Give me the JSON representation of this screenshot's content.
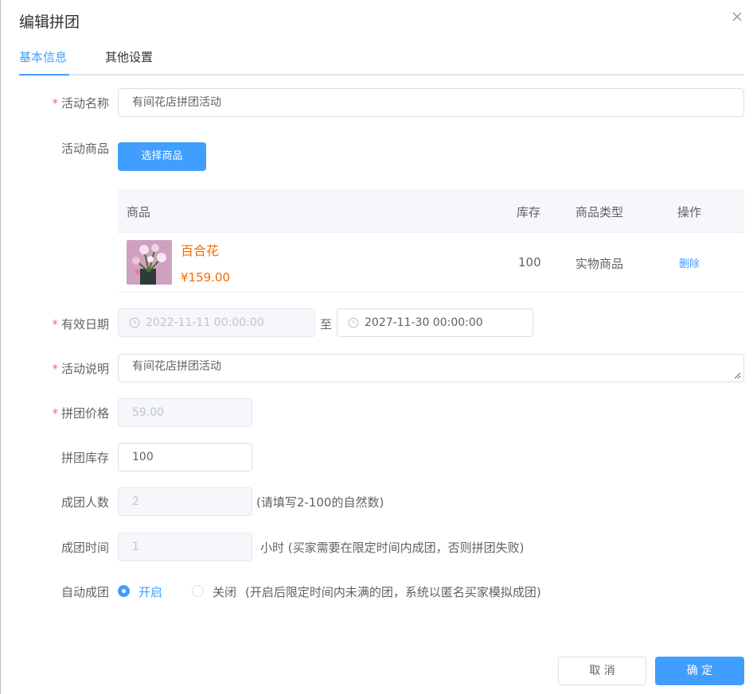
{
  "dialog": {
    "title": "编辑拼团"
  },
  "tabs": [
    {
      "label": "基本信息",
      "active": true
    },
    {
      "label": "其他设置",
      "active": false
    }
  ],
  "form": {
    "activity_name": {
      "label": "活动名称",
      "value": "有间花店拼团活动",
      "required": true
    },
    "activity_goods": {
      "label": "活动商品",
      "button": "选择商品"
    },
    "table": {
      "headers": [
        "商品",
        "库存",
        "商品类型",
        "操作"
      ],
      "rows": [
        {
          "name": "百合花",
          "price": "¥159.00",
          "stock": "100",
          "type": "实物商品",
          "action": "删除",
          "image_icon": "lily-flower-photo"
        }
      ]
    },
    "valid_date": {
      "label": "有效日期",
      "start": "2022-11-11 00:00:00",
      "separator": "至",
      "end": "2027-11-30 00:00:00",
      "required": true
    },
    "description": {
      "label": "活动说明",
      "value": "有间花店拼团活动",
      "required": true
    },
    "group_price": {
      "label": "拼团价格",
      "value": "59.00",
      "required": true
    },
    "group_stock": {
      "label": "拼团库存",
      "value": "100"
    },
    "group_size": {
      "label": "成团人数",
      "value": "2",
      "hint": "(请填写2-100的自然数)"
    },
    "group_time": {
      "label": "成团时间",
      "value": "1",
      "hint": "小时 (买家需要在限定时间内成团，否则拼团失败)"
    },
    "auto_group": {
      "label": "自动成团",
      "options": [
        "开启",
        "关闭"
      ],
      "selected": "开启",
      "hint": "(开启后限定时间内未满的团，系统以匿名买家模拟成团)"
    }
  },
  "footer": {
    "cancel": "取 消",
    "confirm": "确 定"
  },
  "colors": {
    "primary": "#409eff",
    "price": "#f56c00",
    "required": "#f56c6c"
  }
}
